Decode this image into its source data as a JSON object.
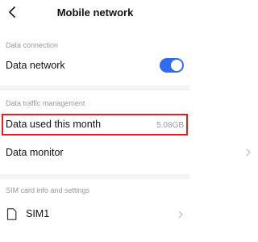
{
  "header": {
    "title": "Mobile network",
    "back_icon": "chevron-left-icon"
  },
  "sections": {
    "data_connection": {
      "label": "Data connection",
      "data_network": {
        "label": "Data network",
        "toggle_on": true
      }
    },
    "traffic": {
      "label": "Data traffic management",
      "data_used": {
        "label": "Data used this month",
        "value": "5.08GB"
      },
      "data_monitor": {
        "label": "Data monitor"
      }
    },
    "sim": {
      "label": "SIM card info and settings",
      "sim1": {
        "label": "SIM1",
        "icon": "sim-card-icon"
      }
    }
  },
  "colors": {
    "accent": "#2f6cf0",
    "highlight": "#e02020"
  }
}
